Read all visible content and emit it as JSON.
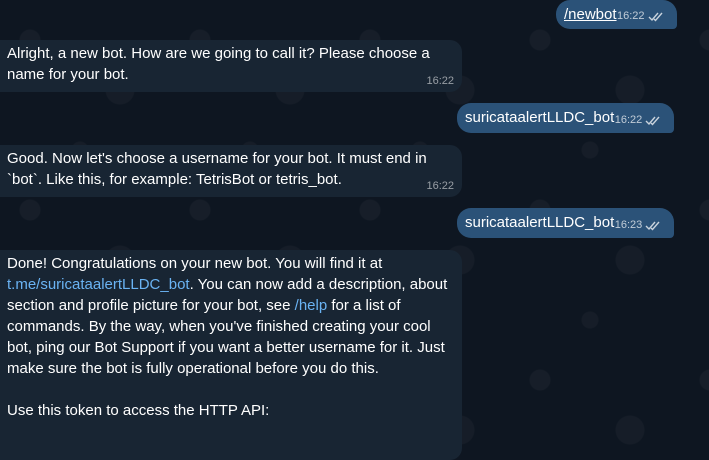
{
  "messages": [
    {
      "dir": "out",
      "text": "/newbot",
      "time": "16:22"
    },
    {
      "dir": "in",
      "text": "Alright, a new bot. How are we going to call it? Please choose a name for your bot.",
      "time": "16:22"
    },
    {
      "dir": "out",
      "text": "suricataalertLLDC_bot",
      "time": "16:22"
    },
    {
      "dir": "in",
      "text": "Good. Now let's choose a username for your bot. It must end in `bot`. Like this, for example: TetrisBot or tetris_bot.",
      "time": "16:22"
    },
    {
      "dir": "out",
      "text": "suricataalertLLDC_bot",
      "time": "16:23"
    },
    {
      "dir": "in",
      "parts": {
        "p1": "Done! Congratulations on your new bot. You will find it at ",
        "link1": "t.me/suricataalertLLDC_bot",
        "p2": ". You can now add a description, about section and profile picture for your bot, see ",
        "link2": "/help",
        "p3": " for a list of commands. By the way, when you've finished creating your cool bot, ping our Bot Support if you want a better username for it. Just make sure the bot is fully operational before you do this.",
        "p4": "Use this token to access the HTTP API:"
      }
    }
  ],
  "colors": {
    "background": "#0e1621",
    "incoming_bubble": "#182533",
    "outgoing_bubble": "#2b5278",
    "link": "#6ab3f3"
  },
  "icons": {
    "read_status": "double-check-icon"
  }
}
